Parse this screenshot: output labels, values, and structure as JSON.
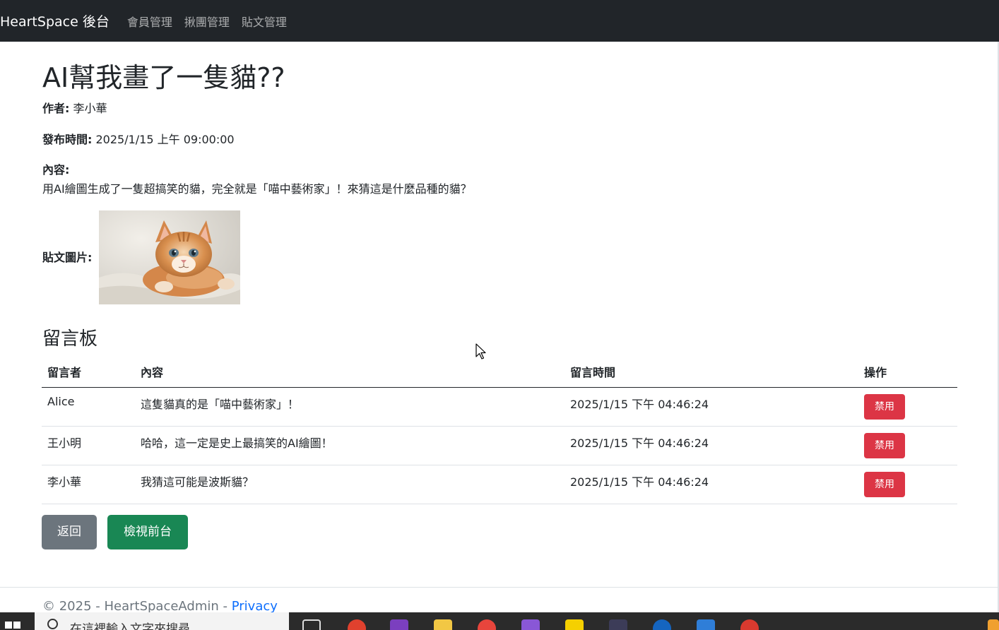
{
  "navbar": {
    "brand": "HeartSpace 後台",
    "links": [
      "會員管理",
      "揪團管理",
      "貼文管理"
    ]
  },
  "post": {
    "title": "AI幫我畫了一隻貓??",
    "author_label": "作者:",
    "author": "李小華",
    "time_label": "發布時間:",
    "time": "2025/1/15 上午 09:00:00",
    "content_label": "內容:",
    "content": "用AI繪圖生成了一隻超搞笑的貓，完全就是「喵中藝術家」！來猜這是什麼品種的貓？",
    "image_label": "貼文圖片:"
  },
  "board": {
    "title": "留言板",
    "headers": [
      "留言者",
      "內容",
      "留言時間",
      "操作"
    ],
    "rows": [
      {
        "user": "Alice",
        "content": "這隻貓真的是「喵中藝術家」！",
        "time": "2025/1/15 下午 04:46:24",
        "action": "禁用"
      },
      {
        "user": "王小明",
        "content": "哈哈，這一定是史上最搞笑的AI繪圖！",
        "time": "2025/1/15 下午 04:46:24",
        "action": "禁用"
      },
      {
        "user": "李小華",
        "content": "我猜這可能是波斯貓？",
        "time": "2025/1/15 下午 04:46:24",
        "action": "禁用"
      }
    ]
  },
  "buttons": {
    "back": "返回",
    "view_front": "檢視前台"
  },
  "footer": {
    "text": "© 2025 - HeartSpaceAdmin - ",
    "privacy": "Privacy"
  },
  "taskbar": {
    "search_placeholder": "在這裡輸入文字來搜尋"
  },
  "colors": {
    "navbar": "#212529",
    "danger": "#dc3545",
    "secondary": "#6c757d",
    "success": "#198754",
    "link": "#0d6efd"
  }
}
